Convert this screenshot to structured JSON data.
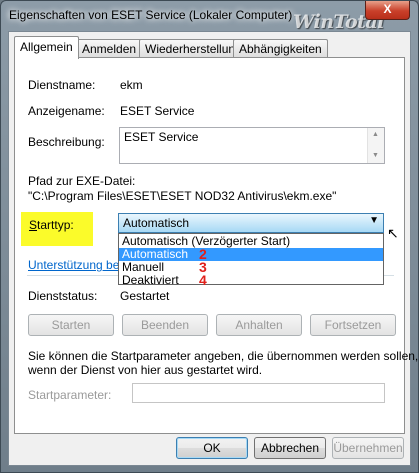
{
  "window": {
    "title": "Eigenschaften von ESET Service (Lokaler Computer)",
    "watermark": "WinTotal",
    "close_label": "X"
  },
  "tabs": [
    "Allgemein",
    "Anmelden",
    "Wiederherstellung",
    "Abhängigkeiten"
  ],
  "general": {
    "service_name_label": "Dienstname:",
    "service_name_value": "ekm",
    "display_name_label": "Anzeigename:",
    "display_name_value": "ESET Service",
    "description_label": "Beschreibung:",
    "description_value": "ESET Service",
    "exe_path_label": "Pfad zur EXE-Datei:",
    "exe_path_value": "\"C:\\Program Files\\ESET\\ESET NOD32 Antivirus\\ekm.exe\"",
    "startup_type_label": "Starttyp:",
    "startup_type_value": "Automatisch",
    "startup_options": [
      {
        "label": "Automatisch (Verzögerter Start)",
        "marker": ""
      },
      {
        "label": "Automatisch",
        "marker": "2"
      },
      {
        "label": "Manuell",
        "marker": "3"
      },
      {
        "label": "Deaktiviert",
        "marker": "4"
      }
    ],
    "help_link": "Unterstützung beim",
    "status_label": "Dienststatus:",
    "status_value": "Gestartet",
    "buttons": {
      "start": "Starten",
      "stop": "Beenden",
      "pause": "Anhalten",
      "resume": "Fortsetzen"
    },
    "hint_line1": "Sie können die Startparameter angeben, die übernommen werden sollen,",
    "hint_line2": "wenn der Dienst von hier aus gestartet wird.",
    "start_params_label": "Startparameter:"
  },
  "footer": {
    "ok": "OK",
    "cancel": "Abbrechen",
    "apply": "Übernehmen"
  },
  "colors": {
    "highlight": "#fbfb2a",
    "selection": "#3399ff",
    "marker": "#e0211c",
    "link": "#0066cc"
  }
}
